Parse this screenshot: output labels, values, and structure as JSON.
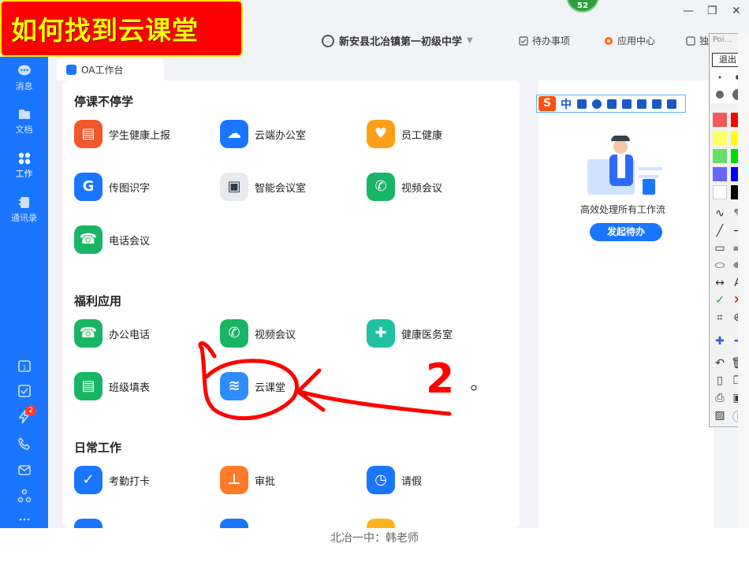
{
  "banner": {
    "title": "如何找到云课堂"
  },
  "notification_count": "52",
  "org": {
    "name": "新安县北冶镇第一初级中学"
  },
  "top_links": [
    {
      "label": "待办事项"
    },
    {
      "label": "应用中心"
    },
    {
      "label": "独"
    }
  ],
  "sidebar": {
    "items": [
      {
        "label": "消息"
      },
      {
        "label": "文档"
      },
      {
        "label": "工作"
      },
      {
        "label": "通讯录"
      }
    ],
    "badge": "2"
  },
  "tab": {
    "label": "OA工作台"
  },
  "sections": {
    "s1": {
      "title": "停课不停学"
    },
    "s2": {
      "title": "福利应用"
    },
    "s3": {
      "title": "日常工作"
    }
  },
  "apps": {
    "a1": {
      "label": "学生健康上报",
      "color": "#f2572d"
    },
    "a2": {
      "label": "云端办公室",
      "color": "#1a75ff"
    },
    "a3": {
      "label": "员工健康",
      "color": "#ff9f19"
    },
    "a4": {
      "label": "传图识字",
      "color": "#1a75ff"
    },
    "a5": {
      "label": "智能会议室",
      "color": "#e8eaee"
    },
    "a6": {
      "label": "视频会议",
      "color": "#18b565"
    },
    "a7": {
      "label": "电话会议",
      "color": "#18b565"
    },
    "b1": {
      "label": "办公电话",
      "color": "#18b565"
    },
    "b2": {
      "label": "视频会议",
      "color": "#18b565"
    },
    "b3": {
      "label": "健康医务室",
      "color": "#1fc1a0"
    },
    "b4": {
      "label": "班级填表",
      "color": "#18b565"
    },
    "b5": {
      "label": "云课堂",
      "color": "#2d8cff"
    },
    "c1": {
      "label": "考勤打卡",
      "color": "#1a75ff"
    },
    "c2": {
      "label": "审批",
      "color": "#ff7a2a"
    },
    "c3": {
      "label": "请假",
      "color": "#1a75ff"
    }
  },
  "ime": {
    "mode": "中"
  },
  "right_panel": {
    "text": "高效处理所有工作流",
    "button": "发起待办"
  },
  "pointer_bar": {
    "title": "Poi...",
    "exit": "退出"
  },
  "annotation": {
    "number": "2"
  },
  "footer": {
    "text": "北冶一中：韩老师"
  }
}
